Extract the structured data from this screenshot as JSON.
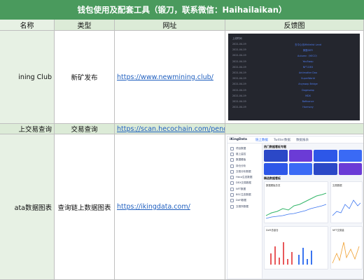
{
  "title": "钱包使用及配套工具（锻刀，联系微信：Haihailaikan）",
  "table": {
    "headers": {
      "name": "名称",
      "type": "类型",
      "url": "网址",
      "feedback": "反馈图"
    },
    "rows": [
      {
        "name": "ining Club",
        "type": "新矿发布",
        "url": "https://www.newmining.club/"
      },
      {
        "name": "上交易查询",
        "type": "交易查询",
        "url": "https://scan.hecochain.com/pending"
      },
      {
        "name": "ata数据图表",
        "type": "查询链上数据图表",
        "url": "https://ikingdata.com/"
      }
    ]
  },
  "dark_feedback": {
    "header": "上线时间",
    "rows": [
      {
        "date": "2021-04-19",
        "link": "去中心化Whitelist Land"
      },
      {
        "date": "2021-04-19",
        "link": "美股DEFI"
      },
      {
        "date": "2021-04-19",
        "link": "Autumn（HECO）"
      },
      {
        "date": "2021-04-19",
        "link": "YouSwap"
      },
      {
        "date": "2021-04-19",
        "link": "NFT-DEX"
      },
      {
        "date": "2021-04-19",
        "link": "Antimatter Dao"
      },
      {
        "date": "2021-04-19",
        "link": "SuperWorld"
      },
      {
        "date": "2021-04-19",
        "link": "Anyswap Bridge"
      },
      {
        "date": "2021-04-19",
        "link": "Dogeswap"
      },
      {
        "date": "2021-04-19",
        "link": "MDX"
      },
      {
        "date": "2021-04-19",
        "link": "Bafinance"
      },
      {
        "date": "2021-04-19",
        "link": "Harmony"
      }
    ]
  },
  "ikingdata": {
    "logo": "iKingData",
    "tabs": [
      "链上数据",
      "Twitter数据",
      "数据报表"
    ],
    "sidebar": [
      "项目数据",
      "链上监控",
      "数据看板",
      "持仓分析",
      "交易分析数据",
      "Heco生态数据",
      "DEX交易数据",
      "NFT数据",
      "BSC生态数据",
      "DeFi数据",
      "交易所数据"
    ],
    "section1": "热门数据看板专题",
    "section2": "精选数据看板",
    "banner_colors": [
      "#2b48c7",
      "#6b3bd6",
      "#2d57e8",
      "#3a6af5"
    ],
    "panel_titles": [
      "数据看板总览",
      "交易数据",
      "DeFi总锁仓",
      "NFT交易量",
      "持仓分布",
      "链上活跃度"
    ],
    "accent_colors": {
      "green": "#34b66a",
      "orange": "#f0a030",
      "blue": "#3a74f0",
      "red": "#e8585a"
    }
  }
}
